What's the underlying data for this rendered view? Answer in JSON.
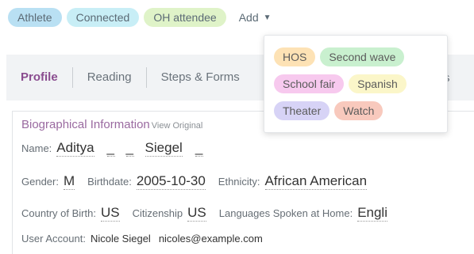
{
  "tags": [
    {
      "label": "Athlete",
      "color": "#b9e0f3"
    },
    {
      "label": "Connected",
      "color": "#c8eef6"
    },
    {
      "label": "OH attendee",
      "color": "#dff3c8"
    }
  ],
  "add": {
    "label": "Add",
    "icon": "caret-down-icon"
  },
  "dropdown": {
    "options": [
      {
        "label": "HOS",
        "color": "#fde2b5"
      },
      {
        "label": "Second wave",
        "color": "#c9f0cf"
      },
      {
        "label": "School fair",
        "color": "#f7c9ee"
      },
      {
        "label": "Spanish",
        "color": "#fbf6c9"
      },
      {
        "label": "Theater",
        "color": "#d7d3f6"
      },
      {
        "label": "Watch",
        "color": "#f8c9bd"
      }
    ]
  },
  "nav": {
    "tabs": [
      "Profile",
      "Reading",
      "Steps & Forms"
    ],
    "tail": "s",
    "active_color": "#8a4c8f"
  },
  "bio": {
    "title": "Biographical Information",
    "view_original": "View Original",
    "name_label": "Name:",
    "first_name": "Aditya",
    "blank1": "_",
    "blank2": "_",
    "last_name": "Siegel",
    "blank3": "_",
    "gender_label": "Gender:",
    "gender": "M",
    "birthdate_label": "Birthdate:",
    "birthdate": "2005-10-30",
    "ethnicity_label": "Ethnicity:",
    "ethnicity": "African American",
    "country_label": "Country of Birth:",
    "country": "US",
    "citizenship_label": "Citizenship",
    "citizenship": "US",
    "languages_label": "Languages Spoken at Home:",
    "languages": "Engli",
    "account_label": "User Account:",
    "account_name": "Nicole Siegel",
    "account_email": "nicoles@example.com"
  }
}
